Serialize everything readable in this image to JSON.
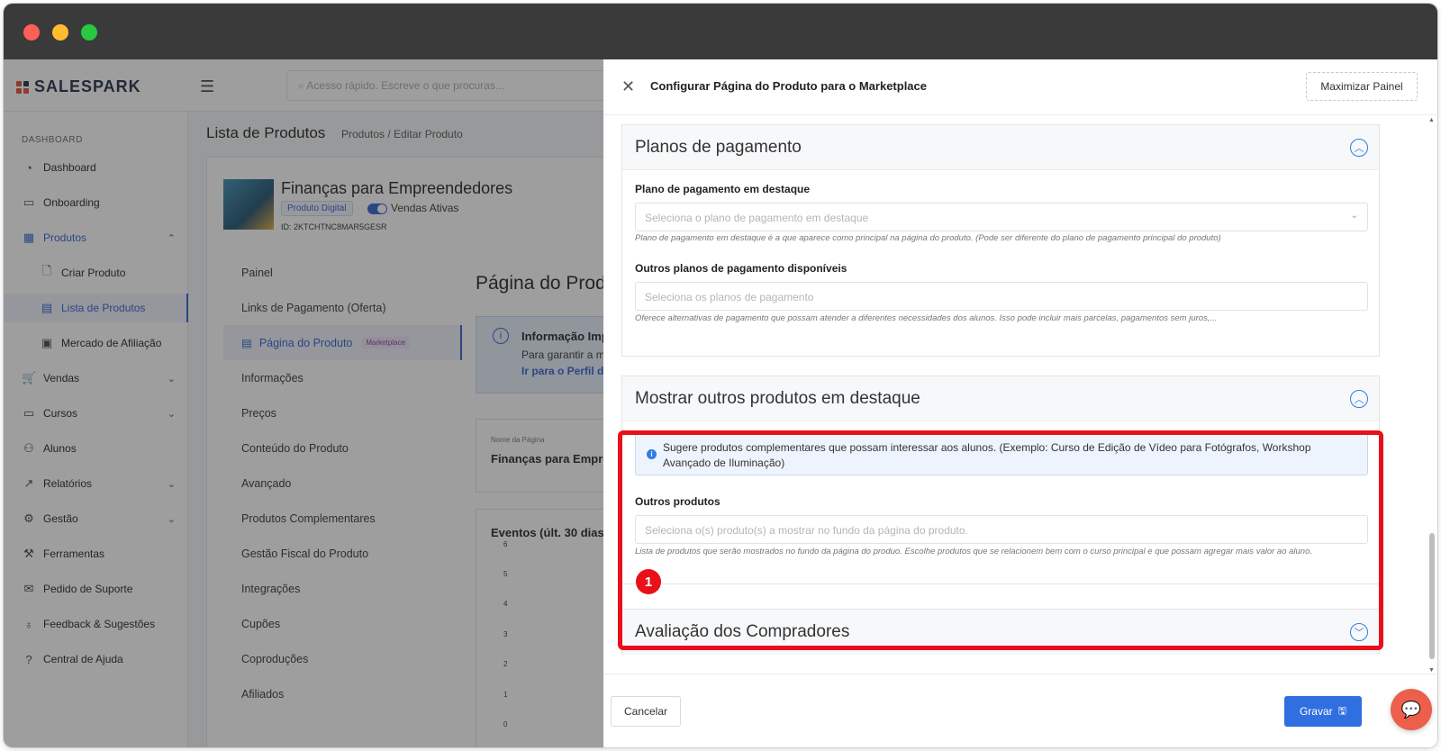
{
  "app": {
    "logo": "SALESPARK",
    "search_placeholder": "Acesso rápido. Escreve o que procuras..."
  },
  "sidebar": {
    "section": "DASHBOARD",
    "items": [
      {
        "label": "Dashboard",
        "icon": "gauge-icon"
      },
      {
        "label": "Onboarding",
        "icon": "video-icon"
      },
      {
        "label": "Produtos",
        "icon": "grid-icon"
      },
      {
        "label": "Criar Produto",
        "icon": "file-plus-icon"
      },
      {
        "label": "Lista de Produtos",
        "icon": "table-icon"
      },
      {
        "label": "Mercado de Afiliação",
        "icon": "store-icon"
      },
      {
        "label": "Vendas",
        "icon": "cart-icon"
      },
      {
        "label": "Cursos",
        "icon": "monitor-icon"
      },
      {
        "label": "Alunos",
        "icon": "users-icon"
      },
      {
        "label": "Relatórios",
        "icon": "chart-icon"
      },
      {
        "label": "Gestão",
        "icon": "gear-icon"
      },
      {
        "label": "Ferramentas",
        "icon": "wrench-icon"
      },
      {
        "label": "Pedido de Suporte",
        "icon": "message-icon"
      },
      {
        "label": "Feedback & Sugestões",
        "icon": "bulb-icon"
      },
      {
        "label": "Central de Ajuda",
        "icon": "help-icon"
      }
    ]
  },
  "main": {
    "title": "Lista de Produtos",
    "breadcrumb": "Produtos  /  Editar Produto",
    "product": {
      "name": "Finanças para Empreendedores",
      "badge": "Produto Digital",
      "toggle_label": "Vendas Ativas",
      "id": "ID: 2KTCHTNC8MAR5GESR"
    },
    "menu": [
      "Painel",
      "Links de Pagamento (Oferta)",
      "Página do Produto",
      "Informações",
      "Preços",
      "Conteúdo do Produto",
      "Avançado",
      "Produtos Complementares",
      "Gestão Fiscal do Produto",
      "Integrações",
      "Cupões",
      "Coproduções",
      "Afiliados"
    ],
    "menu_badge": "Marketplace",
    "content_title": "Página do Prod",
    "info_title": "Informação Imp",
    "info_text": "Para garantir a me",
    "info_link": "Ir para o Perfil de",
    "page_name_label": "Nome da Página",
    "page_name_value": "Finanças para Empre",
    "chart_title": "Eventos (últ. 30 dias)",
    "chart_ticks": [
      "6",
      "5",
      "4",
      "3",
      "2",
      "1",
      "0"
    ]
  },
  "drawer": {
    "title": "Configurar Página do Produto para o Marketplace",
    "maximize": "Maximizar Painel",
    "panels": {
      "payment": {
        "title": "Planos de pagamento",
        "featured_label": "Plano de pagamento em destaque",
        "featured_placeholder": "Seleciona o plano de pagamento em destaque",
        "featured_help": "Plano de pagamento em destaque é a que aparece como principal na página do produto. (Pode ser diferente do plano de pagamento principal do produto)",
        "other_label": "Outros planos de pagamento disponíveis",
        "other_placeholder": "Seleciona os planos de pagamento",
        "other_help": "Oferece alternativas de pagamento que possam atender a diferentes necessidades dos alunos. Isso pode incluir mais parcelas, pagamentos sem juros,..."
      },
      "featured": {
        "title": "Mostrar outros produtos em destaque",
        "info": "Sugere produtos complementares que possam interessar aos alunos. (Exemplo: Curso de Edição de Vídeo para Fotógrafos, Workshop Avançado de Iluminação)",
        "label": "Outros produtos",
        "placeholder": "Seleciona o(s) produto(s) a mostrar no fundo da página do produto.",
        "help": "Lista de produtos que serão mostrados no fundo da página do produo. Escolhe produtos que se relacionem bem com o curso principal e que possam agregar mais valor ao aluno."
      },
      "reviews": {
        "title": "Avaliação dos Compradores"
      }
    },
    "step": "1",
    "cancel": "Cancelar",
    "save": "Gravar"
  },
  "colors": {
    "accent": "#2f6fe0",
    "highlight": "#e8101a",
    "chat": "#ec5f4a"
  }
}
